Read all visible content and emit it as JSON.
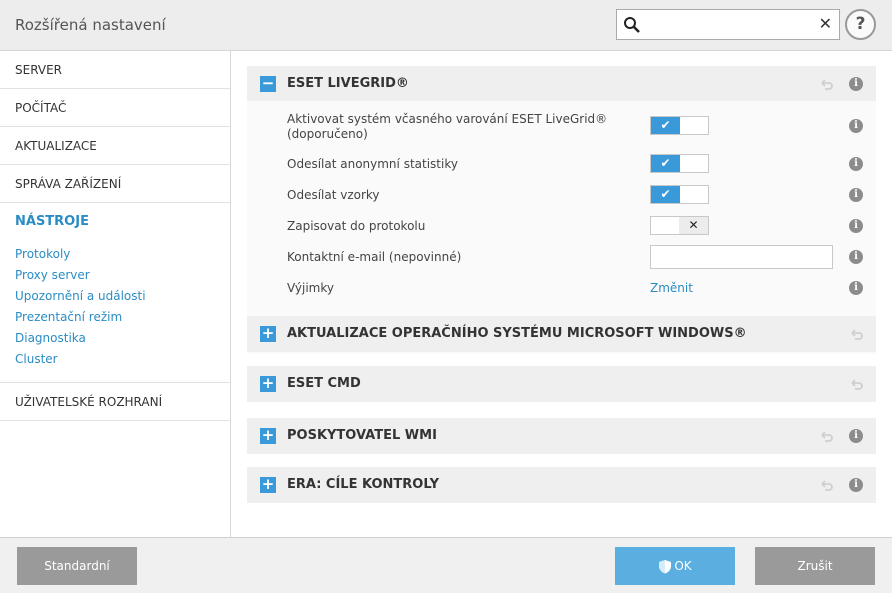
{
  "window": {
    "title": "Rozšířená nastavení"
  },
  "search": {
    "placeholder": "",
    "value": "",
    "clear_label": "✕"
  },
  "help": {
    "label": "?"
  },
  "sidebar": {
    "items": [
      {
        "label": "SERVER"
      },
      {
        "label": "POČÍTAČ"
      },
      {
        "label": "AKTUALIZACE"
      },
      {
        "label": "SPRÁVA ZAŘÍZENÍ"
      }
    ],
    "active": "NÁSTROJE",
    "subitems": [
      "Protokoly",
      "Proxy server",
      "Upozornění a události",
      "Prezentační režim",
      "Diagnostika",
      "Cluster"
    ],
    "bottom_item": "UŽIVATELSKÉ ROZHRANÍ"
  },
  "sections": [
    {
      "title": "ESET LIVEGRID®",
      "expanded": true,
      "toggle_symbol": "−"
    },
    {
      "title": "AKTUALIZACE OPERAČNÍHO SYSTÉMU MICROSOFT WINDOWS®",
      "toggle_symbol": "+"
    },
    {
      "title": "ESET CMD",
      "toggle_symbol": "+"
    },
    {
      "title": "POSKYTOVATEL WMI",
      "toggle_symbol": "+"
    },
    {
      "title": "ERA: CÍLE KONTROLY",
      "toggle_symbol": "+"
    }
  ],
  "livegrid": {
    "rows": [
      {
        "label_line1": "Aktivovat systém včasného varování ESET LiveGrid®",
        "label_line2": "(doporučeno)",
        "state": "on",
        "knob": "✔"
      },
      {
        "label": "Odesílat anonymní statistiky",
        "state": "on",
        "knob": "✔"
      },
      {
        "label": "Odesílat vzorky",
        "state": "on",
        "knob": "✔"
      },
      {
        "label": "Zapisovat do protokolu",
        "state": "off",
        "knob": "✕"
      },
      {
        "label": "Kontaktní e-mail (nepovinné)",
        "value": ""
      },
      {
        "label": "Výjimky",
        "link": "Změnit"
      }
    ]
  },
  "info_symbol": "i",
  "footer": {
    "default_label": "Standardní",
    "ok_label": "OK",
    "cancel_label": "Zrušit"
  },
  "colors": {
    "accent": "#3a9ad9",
    "link": "#2a8cc4",
    "ok_button": "#5aaee0",
    "gray_button": "#9a9a9a"
  }
}
